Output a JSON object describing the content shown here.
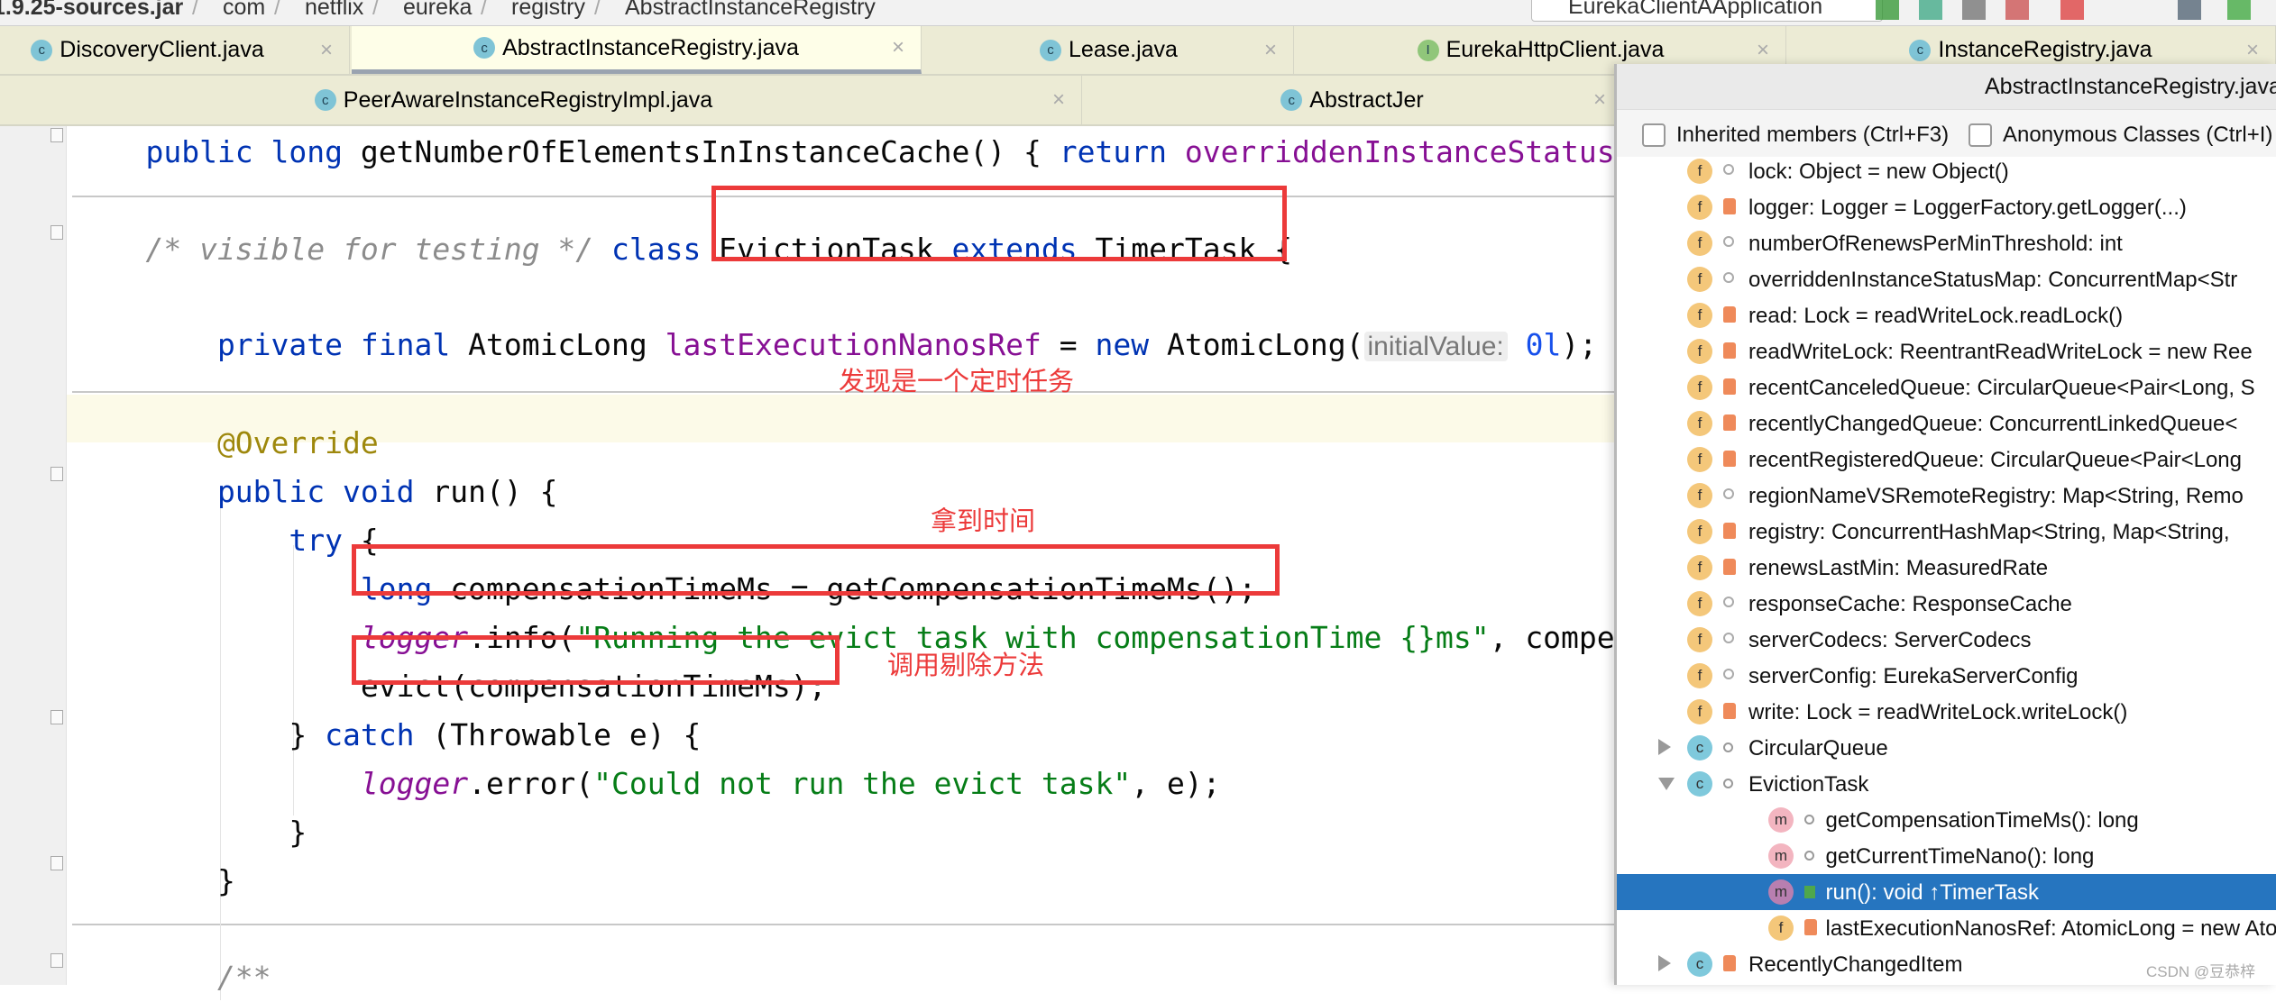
{
  "breadcrumb": [
    "1.9.25-sources.jar",
    "com",
    "netflix",
    "eureka",
    "registry",
    "AbstractInstanceRegistry"
  ],
  "toolbar": {
    "run_config": "EurekaClientAApplication"
  },
  "tabs_row1": [
    {
      "label": "DiscoveryClient.java",
      "icon": "class-icon",
      "active": false
    },
    {
      "label": "AbstractInstanceRegistry.java",
      "icon": "class-icon",
      "active": true
    },
    {
      "label": "Lease.java",
      "icon": "class-icon",
      "active": false
    },
    {
      "label": "EurekaHttpClient.java",
      "icon": "interface-icon",
      "active": false
    },
    {
      "label": "InstanceRegistry.java",
      "icon": "class-icon",
      "active": false
    }
  ],
  "tabs_row2": [
    {
      "label": "PeerAwareInstanceRegistryImpl.java",
      "icon": "class-icon"
    },
    {
      "label": "AbstractJer",
      "icon": "class-icon"
    }
  ],
  "code": [
    [
      [
        "    public long ",
        "kw"
      ],
      [
        "getNumberOfElementsInInstanceCache",
        "plain"
      ],
      [
        "() { ",
        "plain"
      ],
      [
        "return ",
        "kw"
      ],
      [
        "overriddenInstanceStatusMap",
        "fld"
      ]
    ],
    [
      [
        "    /* visible for testing */ ",
        "cm"
      ],
      [
        "class ",
        "kw"
      ],
      [
        "EvictionTask ",
        "plain"
      ],
      [
        "extends ",
        "kw"
      ],
      [
        "TimerTask {",
        "plain"
      ]
    ],
    [
      [
        "        private final ",
        "kw"
      ],
      [
        "AtomicLong ",
        "plain"
      ],
      [
        "lastExecutionNanosRef",
        "fld"
      ],
      [
        " = ",
        "plain"
      ],
      [
        "new ",
        "kw"
      ],
      [
        "AtomicLong(",
        "plain"
      ],
      [
        "initialValue:",
        "hint"
      ],
      [
        " 0l",
        "num"
      ],
      [
        ");",
        "plain"
      ]
    ],
    [
      [
        "        @Override",
        "ann"
      ]
    ],
    [
      [
        "        public void ",
        "kw"
      ],
      [
        "run() {",
        "plain"
      ]
    ],
    [
      [
        "            try ",
        "kw"
      ],
      [
        "{",
        "plain"
      ]
    ],
    [
      [
        "                long ",
        "kw"
      ],
      [
        "compensationTimeMs = getCompensationTimeMs();",
        "plain"
      ]
    ],
    [
      [
        "                logger",
        "log"
      ],
      [
        ".info(",
        "plain"
      ],
      [
        "\"Running the evict task with compensationTime {}ms\"",
        "str"
      ],
      [
        ", compensationTimeMs);",
        "plain"
      ]
    ],
    [
      [
        "                evict(compensationTimeMs);",
        "plain"
      ]
    ],
    [
      [
        "            } ",
        "plain"
      ],
      [
        "catch ",
        "kw"
      ],
      [
        "(Throwable e) {",
        "plain"
      ]
    ],
    [
      [
        "                logger",
        "log"
      ],
      [
        ".error(",
        "plain"
      ],
      [
        "\"Could not run the evict task\"",
        "str"
      ],
      [
        ", e);",
        "plain"
      ]
    ],
    [
      [
        "            }",
        "plain"
      ]
    ],
    [
      [
        "        }",
        "plain"
      ]
    ],
    [
      [
        "        /**",
        "cm"
      ]
    ]
  ],
  "annotations": [
    "发现是一个定时任务",
    "拿到时间",
    "调用剔除方法"
  ],
  "annotation_color": "#ec3a3a",
  "structure_popup": {
    "title": "AbstractInstanceRegistry.java",
    "inherited_label": "Inherited members (Ctrl+F3)",
    "anonymous_label": "Anonymous Classes (Ctrl+I)",
    "items": [
      {
        "label": "lock: Object = new Object()",
        "kind": "f",
        "vis": "pkg",
        "level": 0
      },
      {
        "label": "logger: Logger = LoggerFactory.getLogger(...)",
        "kind": "f",
        "vis": "lock",
        "level": 0
      },
      {
        "label": "numberOfRenewsPerMinThreshold: int",
        "kind": "f",
        "vis": "pkg",
        "level": 0
      },
      {
        "label": "overriddenInstanceStatusMap: ConcurrentMap<Str",
        "kind": "f",
        "vis": "pkg",
        "level": 0
      },
      {
        "label": "read: Lock = readWriteLock.readLock()",
        "kind": "f",
        "vis": "lock",
        "level": 0
      },
      {
        "label": "readWriteLock: ReentrantReadWriteLock = new Ree",
        "kind": "f",
        "vis": "lock",
        "level": 0
      },
      {
        "label": "recentCanceledQueue: CircularQueue<Pair<Long, S",
        "kind": "f",
        "vis": "lock",
        "level": 0
      },
      {
        "label": "recentlyChangedQueue: ConcurrentLinkedQueue<",
        "kind": "f",
        "vis": "lock",
        "level": 0
      },
      {
        "label": "recentRegisteredQueue: CircularQueue<Pair<Long",
        "kind": "f",
        "vis": "lock",
        "level": 0
      },
      {
        "label": "regionNameVSRemoteRegistry: Map<String, Remo",
        "kind": "f",
        "vis": "pkg",
        "level": 0
      },
      {
        "label": "registry: ConcurrentHashMap<String, Map<String,",
        "kind": "f",
        "vis": "lock",
        "level": 0
      },
      {
        "label": "renewsLastMin: MeasuredRate",
        "kind": "f",
        "vis": "lock",
        "level": 0
      },
      {
        "label": "responseCache: ResponseCache",
        "kind": "f",
        "vis": "pkg",
        "level": 0
      },
      {
        "label": "serverCodecs: ServerCodecs",
        "kind": "f",
        "vis": "pkg",
        "level": 0
      },
      {
        "label": "serverConfig: EurekaServerConfig",
        "kind": "f",
        "vis": "pkg",
        "level": 0
      },
      {
        "label": "write: Lock = readWriteLock.writeLock()",
        "kind": "f",
        "vis": "lock",
        "level": 0
      },
      {
        "label": "CircularQueue",
        "kind": "c",
        "vis": "circ",
        "level": 0,
        "expand": "collapsed"
      },
      {
        "label": "EvictionTask",
        "kind": "c",
        "vis": "circ",
        "level": 0,
        "expand": "expanded"
      },
      {
        "label": "getCompensationTimeMs(): long",
        "kind": "m",
        "vis": "circ",
        "level": 1
      },
      {
        "label": "getCurrentTimeNano(): long",
        "kind": "m",
        "vis": "circ",
        "level": 1
      },
      {
        "label": "run(): void ↑TimerTask",
        "kind": "m",
        "vis": "pub",
        "level": 1,
        "selected": true
      },
      {
        "label": "lastExecutionNanosRef: AtomicLong = new Ator",
        "kind": "f",
        "vis": "lock",
        "level": 1
      },
      {
        "label": "RecentlyChangedItem",
        "kind": "c",
        "vis": "lock",
        "level": 0,
        "expand": "collapsed"
      }
    ]
  },
  "watermark": "CSDN @豆恭梓"
}
